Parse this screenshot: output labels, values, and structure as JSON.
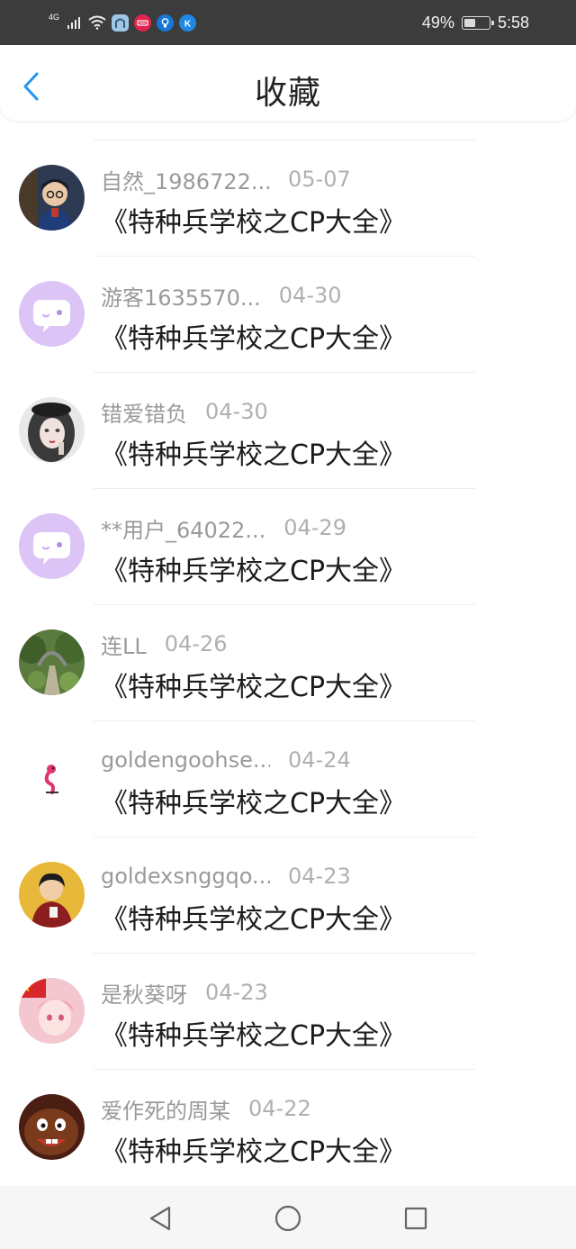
{
  "status_bar": {
    "network": "4G",
    "battery_text": "49%",
    "battery_level": 0.49,
    "time": "5:58",
    "icons": [
      "signal-icon",
      "wifi-icon",
      "app-notification-icon",
      "app-notification-icon",
      "app-notification-icon",
      "app-notification-icon"
    ]
  },
  "header": {
    "back_icon": "chevron-left-icon",
    "title": "收藏",
    "accent": "#2196f3"
  },
  "favorites": [
    {
      "user": "自然_1986722...",
      "date": "05-07",
      "title": "《特种兵学校之CP大全》"
    },
    {
      "user": "游客1635570...",
      "date": "04-30",
      "title": "《特种兵学校之CP大全》"
    },
    {
      "user": "错爱错负",
      "date": "04-30",
      "title": "《特种兵学校之CP大全》"
    },
    {
      "user": "**用户_64022...",
      "date": "04-29",
      "title": "《特种兵学校之CP大全》"
    },
    {
      "user": "连LL",
      "date": "04-26",
      "title": "《特种兵学校之CP大全》"
    },
    {
      "user": "goldengoohse...",
      "date": "04-24",
      "title": "《特种兵学校之CP大全》"
    },
    {
      "user": "goldexsnggqo...",
      "date": "04-23",
      "title": "《特种兵学校之CP大全》"
    },
    {
      "user": "是秋葵呀",
      "date": "04-23",
      "title": "《特种兵学校之CP大全》"
    },
    {
      "user": "爱作死的周某",
      "date": "04-22",
      "title": "《特种兵学校之CP大全》"
    }
  ],
  "nav_bar": {
    "back": "triangle-back-icon",
    "home": "circle-home-icon",
    "recents": "square-recents-icon"
  }
}
